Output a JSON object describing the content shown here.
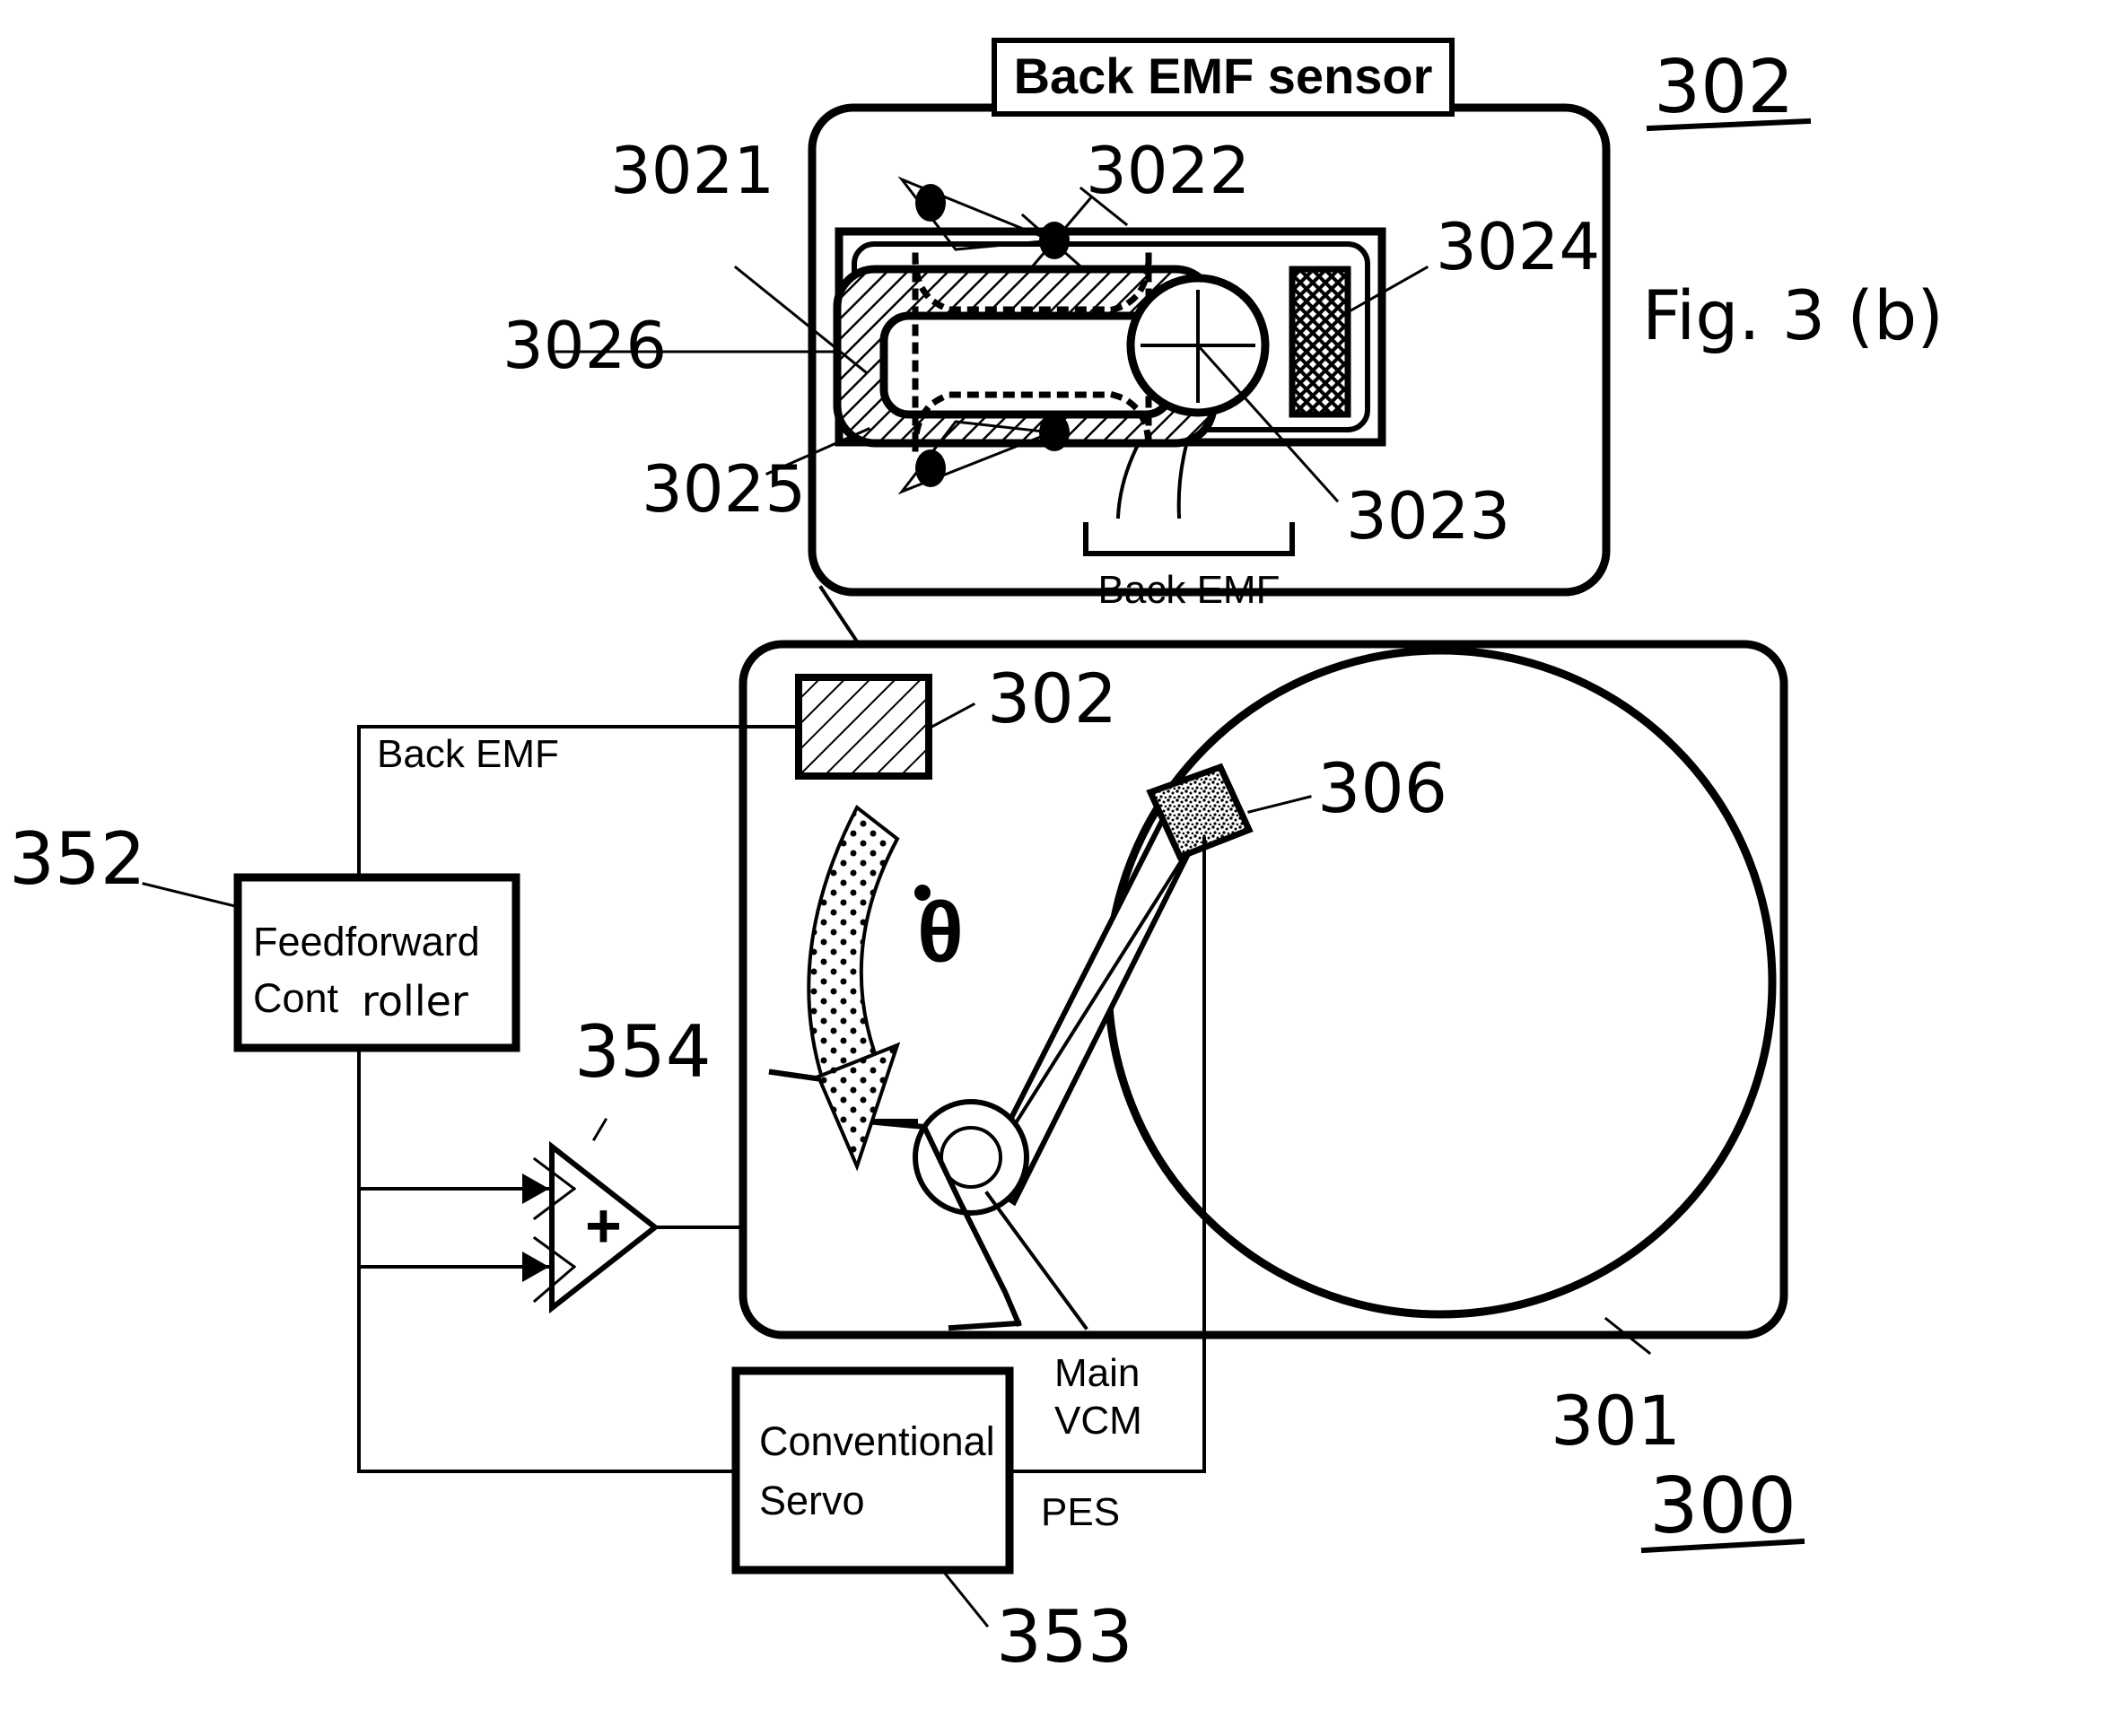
{
  "figure": {
    "caption": "Fig. 3 (b)",
    "top_assembly_ref": "302",
    "bottom_assembly_ref": "300"
  },
  "sensor_module": {
    "title": "Back EMF sensor",
    "output_label": "Back EMF",
    "callouts": {
      "coil_ref": "3021",
      "pivot_ref": "3022",
      "magnet_ref": "3023",
      "stipple_block_ref": "3024",
      "lower_plate_ref": "3025",
      "housing_ref": "3026"
    }
  },
  "drive": {
    "enclosure_ref": "301",
    "sensor_block_ref": "302",
    "head_ref": "306",
    "velocity_symbol": "θ",
    "velocity_dot": "•",
    "main_vcm_label": "Main\nVCM",
    "main_vcm_line1": "Main",
    "main_vcm_line2": "VCM"
  },
  "control": {
    "back_emf_signal_label": "Back EMF",
    "feedforward": {
      "ref": "352",
      "line1": "Feedforward",
      "line2_print": "Cont",
      "line2_hand": "roller"
    },
    "summer": {
      "ref": "354",
      "symbol": "+"
    },
    "conventional_servo": {
      "ref": "353",
      "line1": "Conventional",
      "line2": "Servo"
    },
    "pes_label": "PES"
  },
  "colors": {
    "ink": "#000000",
    "paper": "#ffffff"
  }
}
